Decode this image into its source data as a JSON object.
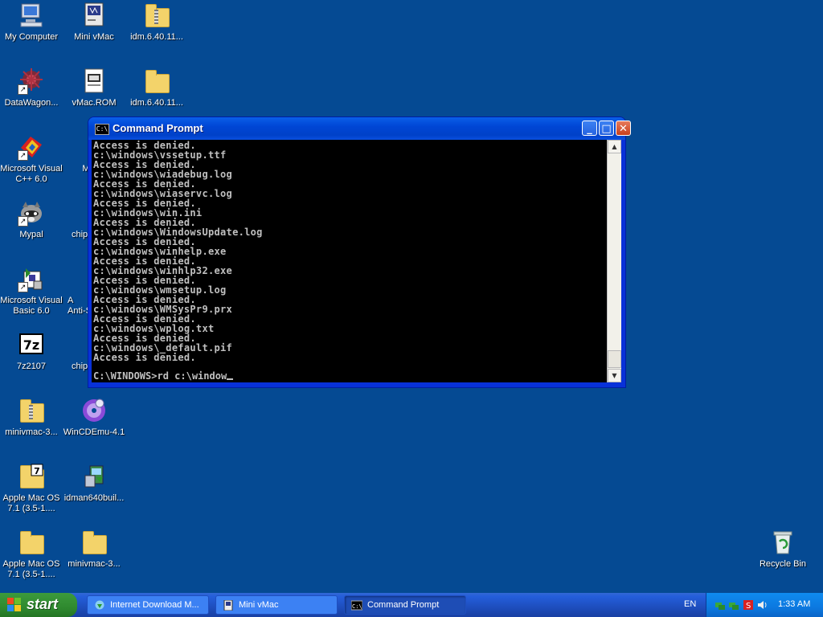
{
  "desktop": {
    "icons": [
      {
        "label": "My Computer"
      },
      {
        "label": "Mini vMac"
      },
      {
        "label": "idm.6.40.11..."
      },
      {
        "label": "DataWagon..."
      },
      {
        "label": "vMac.ROM"
      },
      {
        "label": "idm.6.40.11..."
      },
      {
        "label": "Microsoft Visual\nC++ 6.0"
      },
      {
        "label": "Macin"
      },
      {
        "label": "Mypal"
      },
      {
        "label": "chip"
      },
      {
        "label": "Microsoft Visual\nBasic 6.0"
      },
      {
        "label": "A\nAnti-S"
      },
      {
        "label": "7z2107"
      },
      {
        "label": "chip"
      },
      {
        "label": "minivmac-3..."
      },
      {
        "label": "WinCDEmu-4.1"
      },
      {
        "label": "Apple Mac OS\n7.1 (3.5-1...."
      },
      {
        "label": "idman640buil..."
      },
      {
        "label": "Apple Mac OS\n7.1 (3.5-1...."
      },
      {
        "label": "minivmac-3..."
      },
      {
        "label": "Recycle Bin"
      }
    ]
  },
  "window": {
    "title": "Command Prompt",
    "icon_text": "C:\\",
    "lines": [
      "Access is denied.",
      "c:\\windows\\vssetup.ttf",
      "Access is denied.",
      "c:\\windows\\wiadebug.log",
      "Access is denied.",
      "c:\\windows\\wiaservc.log",
      "Access is denied.",
      "c:\\windows\\win.ini",
      "Access is denied.",
      "c:\\windows\\WindowsUpdate.log",
      "Access is denied.",
      "c:\\windows\\winhelp.exe",
      "Access is denied.",
      "c:\\windows\\winhlp32.exe",
      "Access is denied.",
      "c:\\windows\\wmsetup.log",
      "Access is denied.",
      "c:\\windows\\WMSysPr9.prx",
      "Access is denied.",
      "c:\\windows\\wplog.txt",
      "Access is denied.",
      "c:\\windows\\_default.pif",
      "Access is denied."
    ],
    "prompt": "C:\\WINDOWS>rd c:\\window"
  },
  "taskbar": {
    "start_label": "start",
    "items": [
      {
        "label": "Internet Download M..."
      },
      {
        "label": "Mini vMac"
      },
      {
        "label": "Command Prompt"
      }
    ],
    "language": "EN",
    "clock": "1:33 AM"
  }
}
